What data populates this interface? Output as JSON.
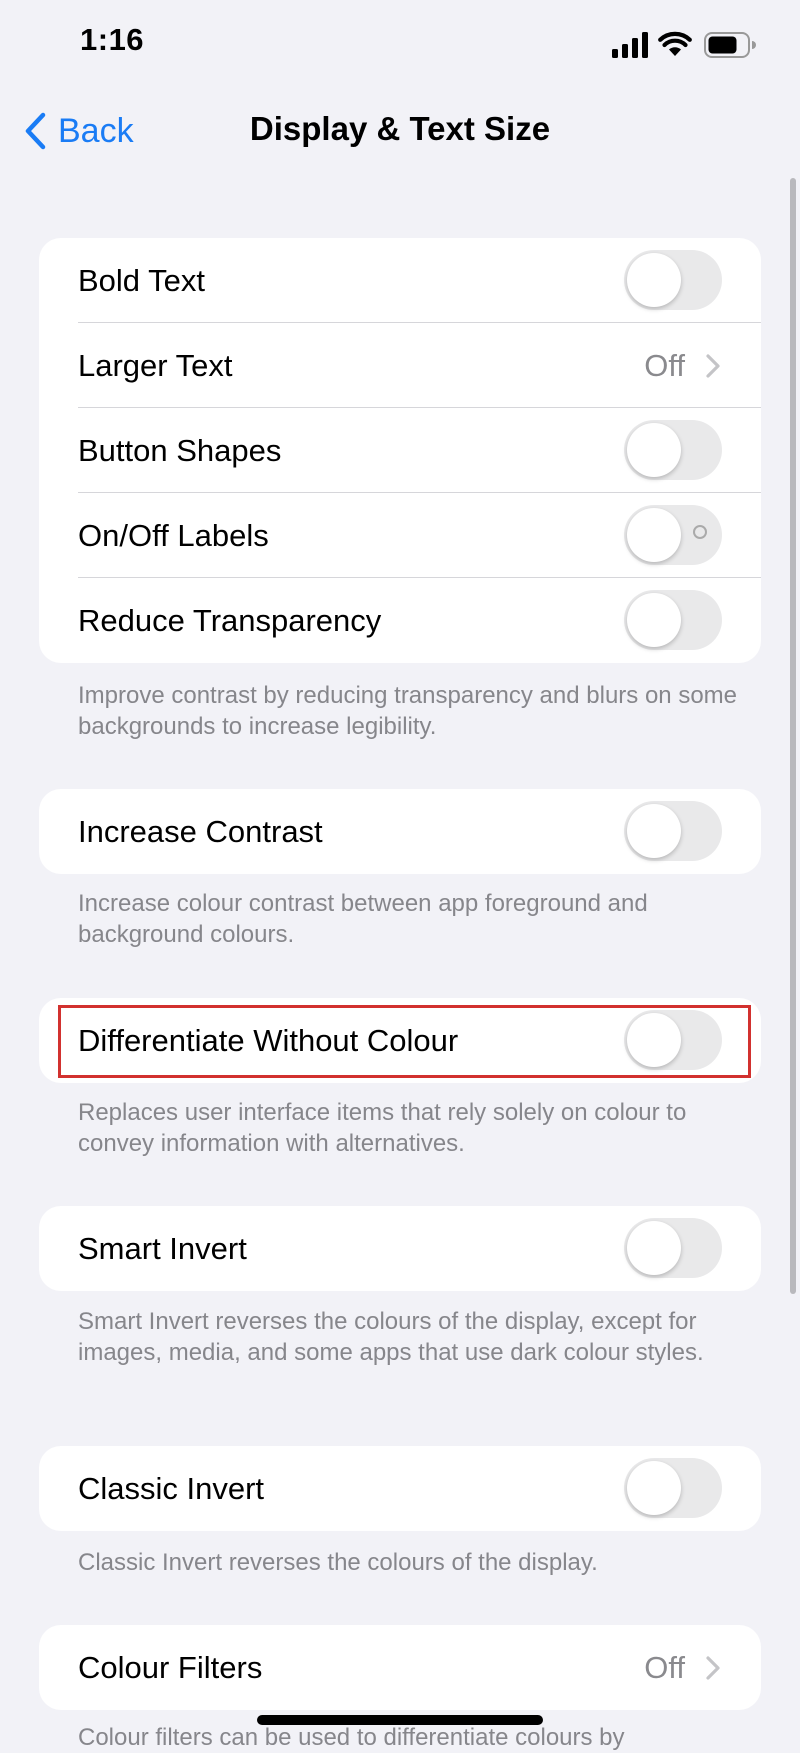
{
  "status_bar": {
    "time": "1:16",
    "battery_icon": "battery-icon",
    "wifi_icon": "wifi-icon",
    "signal_icon": "cellular-signal-icon"
  },
  "nav": {
    "back_label": "Back",
    "title": "Display & Text Size"
  },
  "colors": {
    "accent": "#1a7cf5",
    "background": "#f2f2f7",
    "highlight": "#d2312f",
    "toggle_off": "#e9e9ea"
  },
  "groups": [
    {
      "rows": [
        {
          "label": "Bold Text",
          "type": "toggle",
          "on": false
        },
        {
          "label": "Larger Text",
          "type": "value",
          "value": "Off"
        },
        {
          "label": "Button Shapes",
          "type": "toggle",
          "on": false
        },
        {
          "label": "On/Off Labels",
          "type": "toggle",
          "on": false
        },
        {
          "label": "Reduce Transparency",
          "type": "toggle",
          "on": false
        }
      ],
      "footer": "Improve contrast by reducing transparency and blurs on some backgrounds to increase legibility."
    },
    {
      "rows": [
        {
          "label": "Increase Contrast",
          "type": "toggle",
          "on": false
        }
      ],
      "footer": "Increase colour contrast between app foreground and background colours."
    },
    {
      "rows": [
        {
          "label": "Differentiate Without Colour",
          "type": "toggle",
          "on": false
        }
      ],
      "footer": "Replaces user interface items that rely solely on colour to convey information with alternatives."
    },
    {
      "rows": [
        {
          "label": "Smart Invert",
          "type": "toggle",
          "on": false
        }
      ],
      "footer": "Smart Invert reverses the colours of the display, except for images, media, and some apps that use dark colour styles."
    },
    {
      "rows": [
        {
          "label": "Classic Invert",
          "type": "toggle",
          "on": false
        }
      ],
      "footer": "Classic Invert reverses the colours of the display."
    },
    {
      "rows": [
        {
          "label": "Colour Filters",
          "type": "value",
          "value": "Off"
        }
      ],
      "footer": "Colour filters can be used to differentiate colours by"
    }
  ]
}
